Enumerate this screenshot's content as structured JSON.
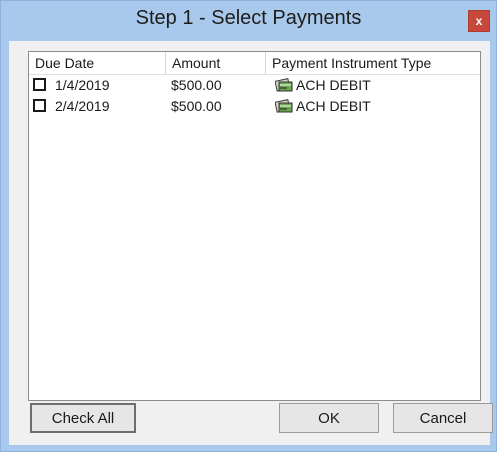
{
  "window": {
    "title": "Step 1 - Select Payments",
    "close_glyph": "x"
  },
  "table": {
    "columns": [
      "Due Date",
      "Amount",
      "Payment Instrument Type"
    ],
    "rows": [
      {
        "checked": false,
        "due_date": "1/4/2019",
        "amount": "$500.00",
        "icon": "ach-debit-icon",
        "type": "ACH DEBIT"
      },
      {
        "checked": false,
        "due_date": "2/4/2019",
        "amount": "$500.00",
        "icon": "ach-debit-icon",
        "type": "ACH DEBIT"
      }
    ]
  },
  "buttons": {
    "check_all": "Check All",
    "ok": "OK",
    "cancel": "Cancel"
  },
  "colors": {
    "frame": "#a9c9ec",
    "close": "#c7493c",
    "client": "#f0f0f0"
  }
}
